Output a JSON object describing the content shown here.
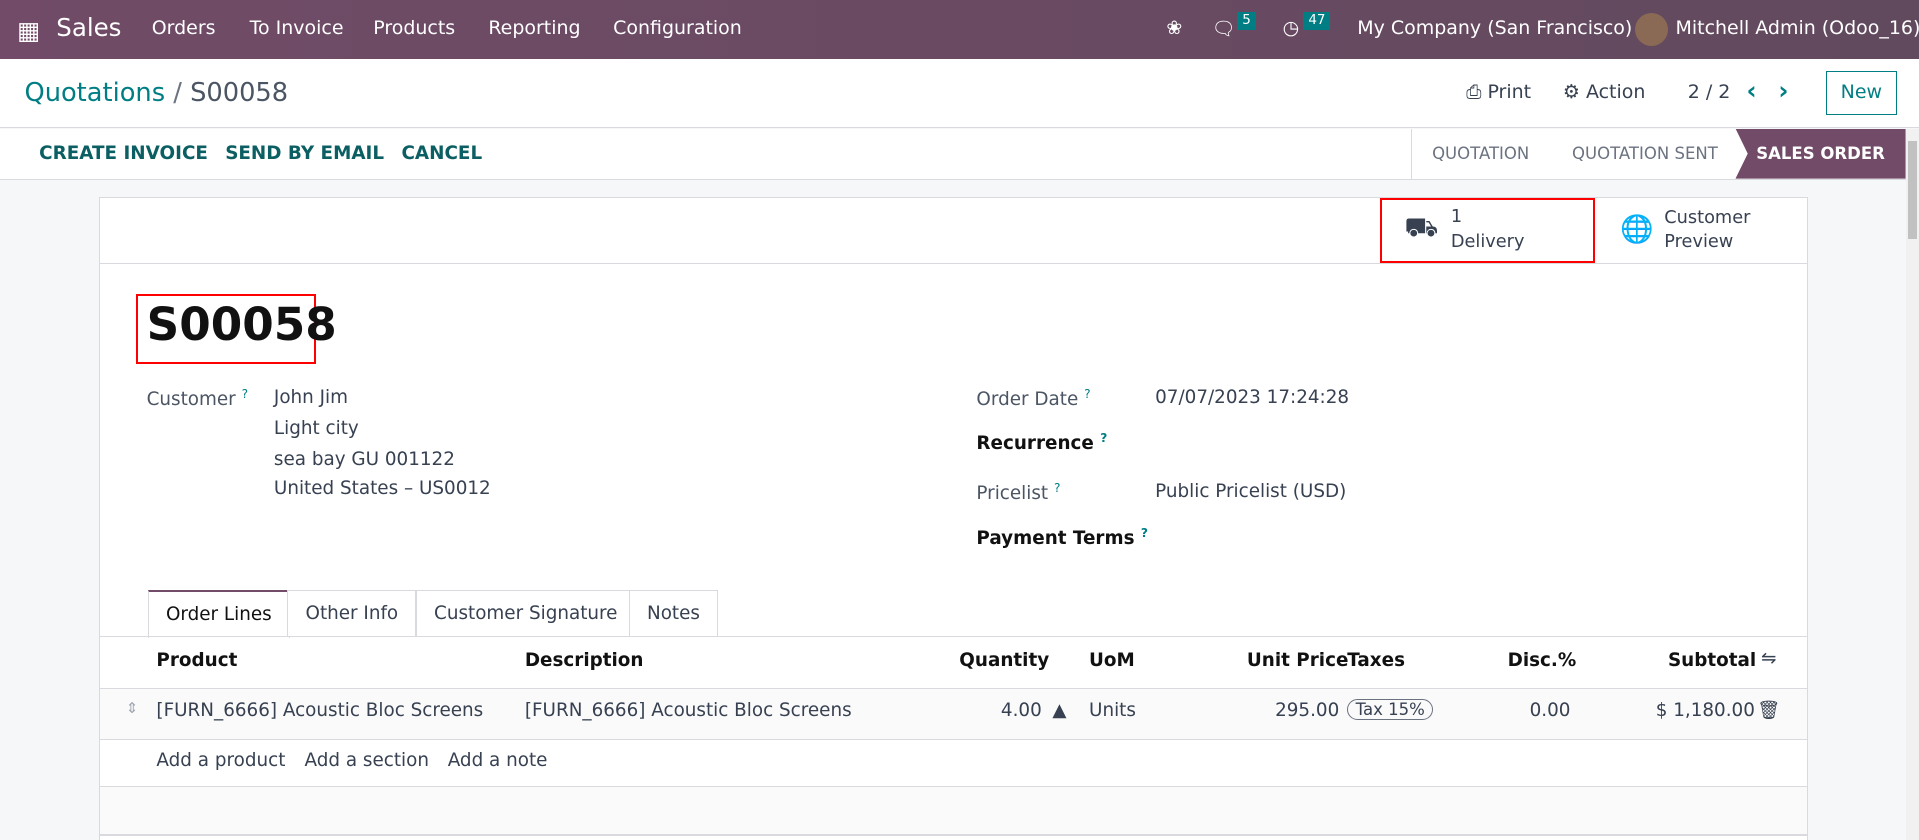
{
  "nav": {
    "app": "Sales",
    "menu": [
      "Orders",
      "To Invoice",
      "Products",
      "Reporting",
      "Configuration"
    ],
    "messages_count": "5",
    "activities_count": "47",
    "company": "My Company (San Francisco)",
    "user": "Mitchell Admin (Odoo_16)"
  },
  "breadcrumb": {
    "parent": "Quotations",
    "separator": "/",
    "current": "S00058"
  },
  "controls": {
    "print": "Print",
    "action": "Action",
    "pager": "2 / 2",
    "new": "New"
  },
  "statusbar": {
    "buttons": [
      "CREATE INVOICE",
      "SEND BY EMAIL",
      "CANCEL"
    ],
    "stages": [
      "QUOTATION",
      "QUOTATION SENT",
      "SALES ORDER"
    ],
    "active_stage": "SALES ORDER"
  },
  "smart_buttons": {
    "delivery_count": "1",
    "delivery_label": "Delivery",
    "preview_line1": "Customer",
    "preview_line2": "Preview"
  },
  "form": {
    "name": "S00058",
    "customer_label": "Customer",
    "customer_name": "John Jim",
    "address": [
      "Light city",
      "sea bay GU 001122",
      "United States – US0012"
    ],
    "order_date_label": "Order Date",
    "order_date": "07/07/2023 17:24:28",
    "recurrence_label": "Recurrence",
    "pricelist_label": "Pricelist",
    "pricelist": "Public Pricelist (USD)",
    "payment_terms_label": "Payment Terms",
    "help": "?"
  },
  "tabs": [
    "Order Lines",
    "Other Info",
    "Customer Signature",
    "Notes"
  ],
  "table": {
    "headers": [
      "Product",
      "Description",
      "Quantity",
      "UoM",
      "Unit Price",
      "Taxes",
      "Disc.%",
      "Subtotal"
    ],
    "rows": [
      {
        "product": "[FURN_6666] Acoustic Bloc Screens",
        "description": "[FURN_6666] Acoustic Bloc Screens",
        "quantity": "4.00",
        "uom": "Units",
        "unit_price": "295.00",
        "taxes": "Tax 15%",
        "discount": "0.00",
        "subtotal": "$ 1,180.00"
      }
    ],
    "add_links": [
      "Add a product",
      "Add a section",
      "Add a note"
    ]
  },
  "colors": {
    "brand": "#714b67",
    "accent": "#017e84",
    "highlight": "#ff0000"
  }
}
